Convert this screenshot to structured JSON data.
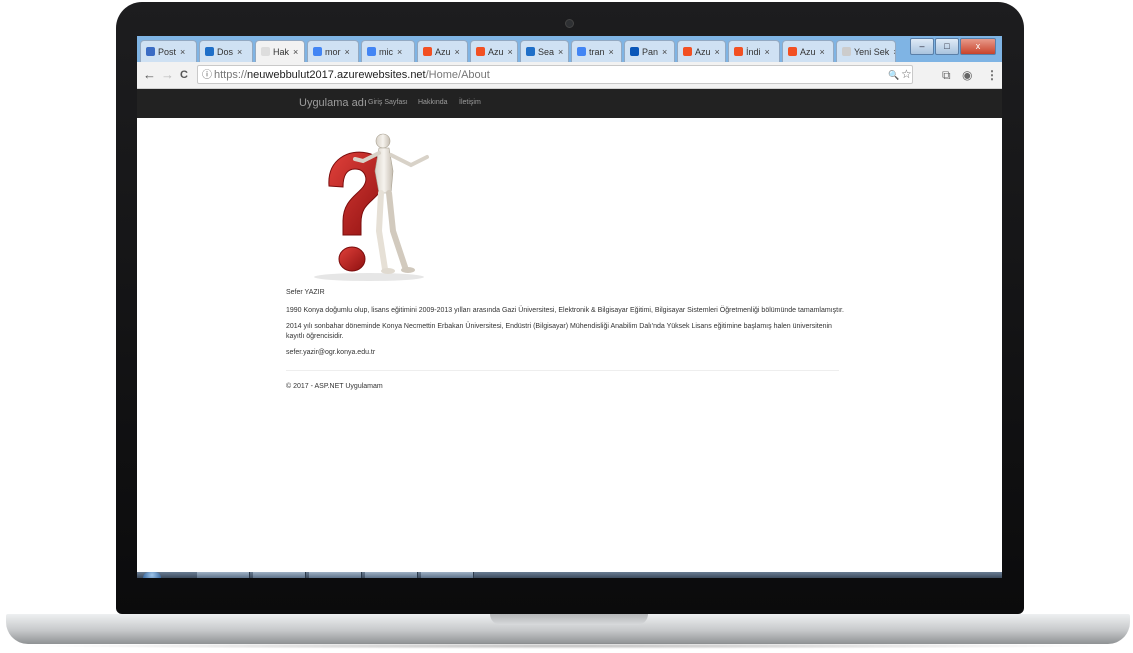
{
  "browser": {
    "tabs": [
      {
        "label": "Post",
        "color": "#3b6cc4"
      },
      {
        "label": "Dos",
        "color": "#1f6fc8"
      },
      {
        "label": "Hak",
        "color": "#dddddd",
        "active": true
      },
      {
        "label": "mor",
        "color": "#4285f4"
      },
      {
        "label": "mic",
        "color": "#4285f4"
      },
      {
        "label": "Azu",
        "color": "#f25022"
      },
      {
        "label": "Azu",
        "color": "#f25022"
      },
      {
        "label": "Sea",
        "color": "#1f6fc8"
      },
      {
        "label": "tran",
        "color": "#4285f4"
      },
      {
        "label": "Pan",
        "color": "#0b57b8"
      },
      {
        "label": "Azu",
        "color": "#f25022"
      },
      {
        "label": "İndi",
        "color": "#f25022"
      },
      {
        "label": "Azu",
        "color": "#f25022"
      },
      {
        "label": "Yeni Sek",
        "color": "#cccccc"
      }
    ],
    "tab_close": "×",
    "window_controls": {
      "minimize": "–",
      "maximize": "□",
      "close": "x"
    },
    "nav": {
      "back": "←",
      "forward": "→",
      "reload": "C"
    },
    "address": {
      "info_icon": "ⓘ",
      "scheme": "https://",
      "host": "neuwebbulut2017.azurewebsites.net",
      "path": "/Home/About"
    },
    "toolbar_icons": {
      "zoom": "🔍",
      "star": "☆",
      "ext1": "⧉",
      "ext2": "◉",
      "menu": "⋮"
    }
  },
  "site": {
    "brand": "Uygulama adı",
    "nav": [
      "Giriş Sayfası",
      "Hakkında",
      "İletişim"
    ],
    "name": "Sefer YAZIR",
    "para1": "1990 Konya doğumlu olup, lisans eğitimini 2009-2013 yılları arasında Gazi Üniversitesi, Elektronik & Bilgisayar Eğitimi, Bilgisayar Sistemleri Öğretmenliği bölümünde tamamlamıştır.",
    "para2": "2014 yılı sonbahar döneminde Konya Necmettin Erbakan Üniversitesi, Endüstri (Bilgisayar) Mühendisliği Anabilim Dalı'nda Yüksek Lisans eğitimine başlamış halen üniversitenin kayıtlı öğrencisidir.",
    "email": "sefer.yazir@ogr.konya.edu.tr",
    "footer": "© 2017 - ASP.NET Uygulamam"
  },
  "colors": {
    "navbar_bg": "#222222",
    "nav_text": "#9d9d9d",
    "question_mark": "#c0201e",
    "tabstrip": "#7fb4e4"
  }
}
